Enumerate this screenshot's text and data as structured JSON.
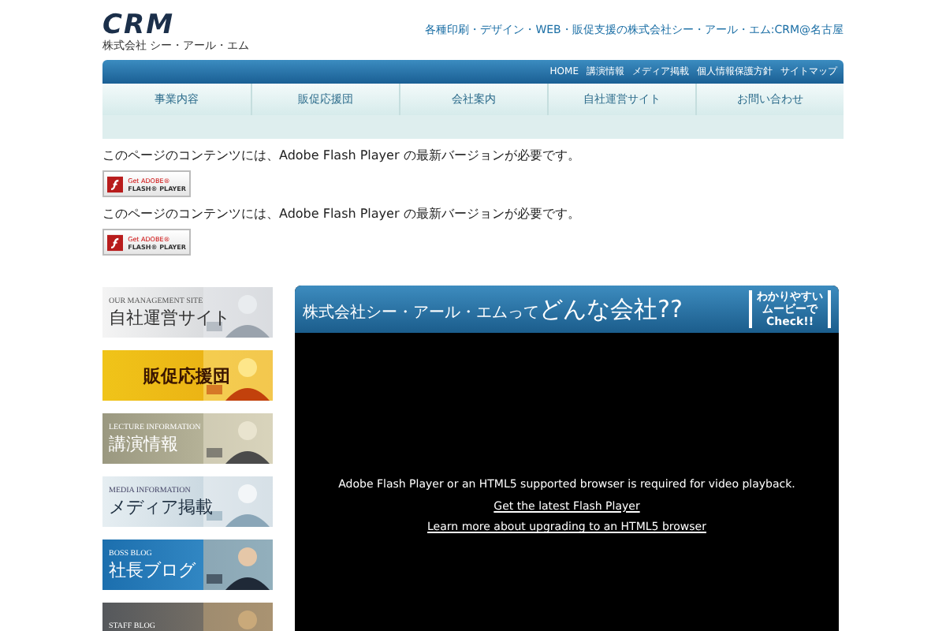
{
  "header": {
    "logo": "CRM",
    "logo_sub": "株式会社 シー・アール・エム",
    "tagline": "各種印刷・デザイン・WEB・販促支援の株式会社シー・アール・エム:CRM@名古屋"
  },
  "top_links": [
    "HOME",
    "講演情報",
    "メディア掲載",
    "個人情報保護方針",
    "サイトマップ"
  ],
  "nav": [
    "事業内容",
    "販促応援団",
    "会社案内",
    "自社運営サイト",
    "お問い合わせ"
  ],
  "flash_notices": [
    {
      "message": "このページのコンテンツには、Adobe Flash Player の最新バージョンが必要です。",
      "badge_top": "Get ADOBE®",
      "badge_bottom": "FLASH® PLAYER"
    },
    {
      "message": "このページのコンテンツには、Adobe Flash Player の最新バージョンが必要です。",
      "badge_top": "Get ADOBE®",
      "badge_bottom": "FLASH® PLAYER"
    }
  ],
  "banners": [
    {
      "kind": "light",
      "caption": "OUR MANAGEMENT SITE",
      "title": "自社運営サイト"
    },
    {
      "kind": "gold",
      "title": "販促応援団"
    },
    {
      "kind": "olive",
      "caption": "LECTURE INFORMATION",
      "title": "講演情報"
    },
    {
      "kind": "pale",
      "caption": "MEDIA INFORMATION",
      "title": "メディア掲載"
    },
    {
      "kind": "blue",
      "caption": "BOSS BLOG",
      "title": "社長ブログ"
    },
    {
      "kind": "dark",
      "caption": "STAFF BLOG"
    }
  ],
  "video": {
    "title_small": "株式会社シー・アール・エムって",
    "title_large": "どんな会社??",
    "badge": [
      "わかりやすい",
      "ムービーで",
      "Check!!"
    ],
    "message": "Adobe Flash Player or an HTML5 supported browser is required for video playback.",
    "links": [
      "Get the latest Flash Player",
      "Learn more about upgrading to an HTML5 browser"
    ]
  }
}
